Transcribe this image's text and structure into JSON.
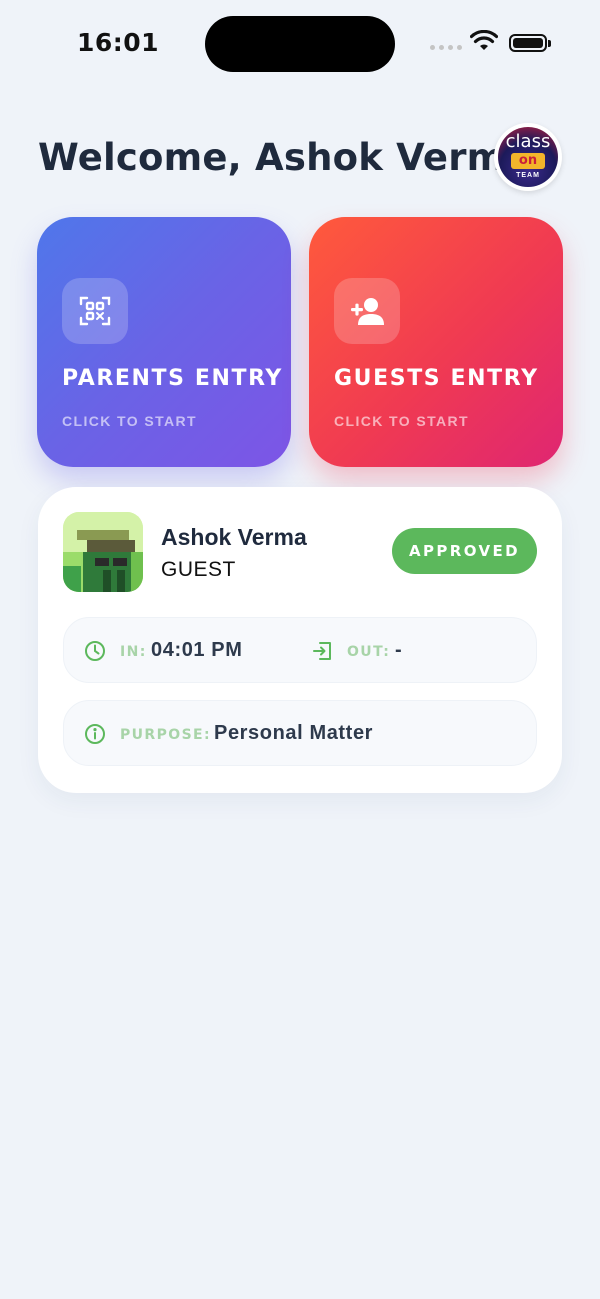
{
  "status_bar": {
    "time": "16:01"
  },
  "header": {
    "welcome_text": "Welcome, Ashok Verma",
    "logo": {
      "line1": "class",
      "line2": "on",
      "line3": "TEAM"
    }
  },
  "entries": [
    {
      "title": "PARENTS ENTRY",
      "subtitle": "CLICK TO START",
      "icon": "qr-code-scan-icon",
      "gradient": [
        "#4f77ea",
        "#7d55e6"
      ]
    },
    {
      "title": "GUESTS ENTRY",
      "subtitle": "CLICK TO START",
      "icon": "add-person-icon",
      "gradient": [
        "#ff5a3c",
        "#df2672"
      ]
    }
  ],
  "visit": {
    "name": "Ashok Verma",
    "type": "GUEST",
    "status": "APPROVED",
    "status_color": "#5cb85c",
    "in_label": "IN:",
    "in_time": "04:01 PM",
    "out_label": "OUT:",
    "out_time": "-",
    "purpose_label": "PURPOSE:",
    "purpose": "Personal Matter",
    "accent": "#5cb85c"
  }
}
